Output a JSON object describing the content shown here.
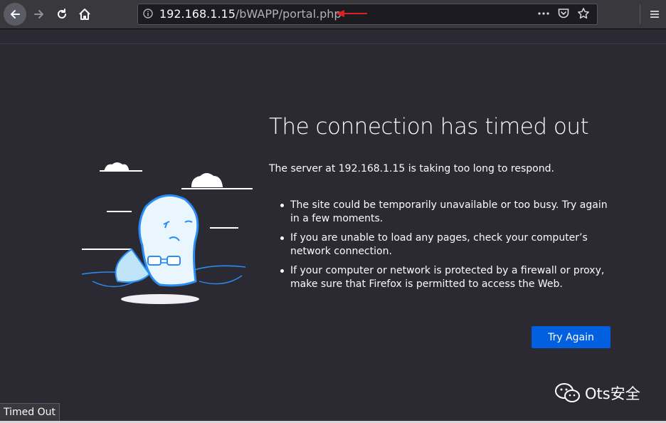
{
  "toolbar": {
    "url_host": "192.168.1.15",
    "url_path": "/bWAPP/portal.php",
    "page_actions_icon": "ellipsis-icon",
    "pocket_icon": "pocket-icon",
    "bookmark_icon": "star-icon",
    "menu_icon": "hamburger-icon"
  },
  "error": {
    "title": "The connection has timed out",
    "description": "The server at 192.168.1.15 is taking too long to respond.",
    "bullets": [
      "The site could be temporarily unavailable or too busy. Try again in a few moments.",
      "If you are unable to load any pages, check your computer’s network connection.",
      "If your computer or network is protected by a firewall or proxy, make sure that Firefox is permitted to access the Web."
    ],
    "try_again_label": "Try Again"
  },
  "watermark": {
    "text": "Ots安全"
  },
  "status": {
    "text": "Timed Out"
  },
  "colors": {
    "accent": "#0060df",
    "background": "#2b2a33",
    "annotation_arrow": "#e02020"
  }
}
